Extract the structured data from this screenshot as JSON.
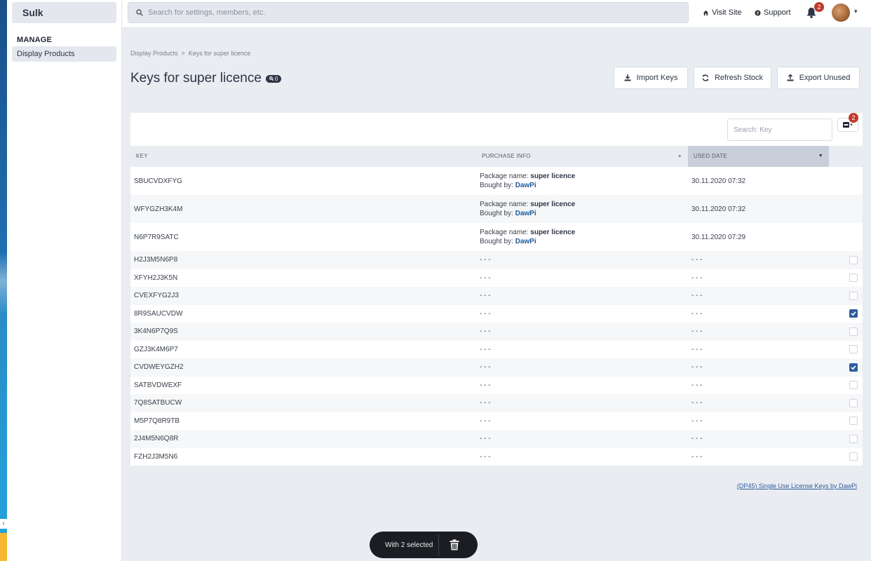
{
  "app": {
    "brand": "Sulk"
  },
  "sidebar": {
    "section": "MANAGE",
    "items": [
      {
        "label": "Display Products"
      }
    ]
  },
  "topbar": {
    "search_placeholder": "Search for settings, members, etc.",
    "visit_site": "Visit Site",
    "support": "Support",
    "notification_count": "2"
  },
  "breadcrumb": {
    "items": [
      "Display Products",
      "Keys for super licence"
    ],
    "separator": ">"
  },
  "page": {
    "title": "Keys for super licence",
    "badge_count": "0"
  },
  "actions": {
    "import": "Import Keys",
    "refresh": "Refresh Stock",
    "export": "Export Unused"
  },
  "table": {
    "search_placeholder": "Search: Key",
    "column_toggle_badge": "2",
    "columns": {
      "key": "KEY",
      "info": "PURCHASE INFO",
      "date": "USED DATE"
    },
    "info_labels": {
      "package": "Package name:",
      "bought": "Bought by:"
    },
    "used_rows": [
      {
        "key": "SBUCVDXFYG",
        "package": "super licence",
        "buyer": "DawPi",
        "date": "30.11.2020 07:32"
      },
      {
        "key": "WFYGZH3K4M",
        "package": "super licence",
        "buyer": "DawPi",
        "date": "30.11.2020 07:32"
      },
      {
        "key": "N6P7R9SATC",
        "package": "super licence",
        "buyer": "DawPi",
        "date": "30.11.2020 07:29"
      }
    ],
    "unused_rows": [
      {
        "key": "H2J3M5N6P8",
        "info": "- - -",
        "date": "- - -",
        "checked": false
      },
      {
        "key": "XFYH2J3K5N",
        "info": "- - -",
        "date": "- - -",
        "checked": false
      },
      {
        "key": "CVEXFYG2J3",
        "info": "- - -",
        "date": "- - -",
        "checked": false
      },
      {
        "key": "8R9SAUCVDW",
        "info": "- - -",
        "date": "- - -",
        "checked": true
      },
      {
        "key": "3K4N6P7Q9S",
        "info": "- - -",
        "date": "- - -",
        "checked": false
      },
      {
        "key": "GZJ3K4M6P7",
        "info": "- - -",
        "date": "- - -",
        "checked": false
      },
      {
        "key": "CVDWEYGZH2",
        "info": "- - -",
        "date": "- - -",
        "checked": true
      },
      {
        "key": "SATBVDWEXF",
        "info": "- - -",
        "date": "- - -",
        "checked": false
      },
      {
        "key": "7Q8SATBUCW",
        "info": "- - -",
        "date": "- - -",
        "checked": false
      },
      {
        "key": "M5P7Q8R9TB",
        "info": "- - -",
        "date": "- - -",
        "checked": false
      },
      {
        "key": "2J4M5N6Q8R",
        "info": "- - -",
        "date": "- - -",
        "checked": false
      },
      {
        "key": "FZH2J3M5N6",
        "info": "- - -",
        "date": "- - -",
        "checked": false
      }
    ]
  },
  "footer": {
    "link": "(DP45) Single Use License Keys by DawPi"
  },
  "selection_bar": {
    "text": "With 2 selected"
  },
  "colors": {
    "accent": "#2f5d9e",
    "badge": "#c0392b",
    "dark": "#1b1d22"
  },
  "icons": [
    "search-icon",
    "home-icon",
    "question-icon",
    "bell-icon",
    "chevron-down-icon",
    "download-icon",
    "refresh-icon",
    "upload-icon",
    "column-toggle-icon",
    "trash-icon",
    "check-icon"
  ]
}
